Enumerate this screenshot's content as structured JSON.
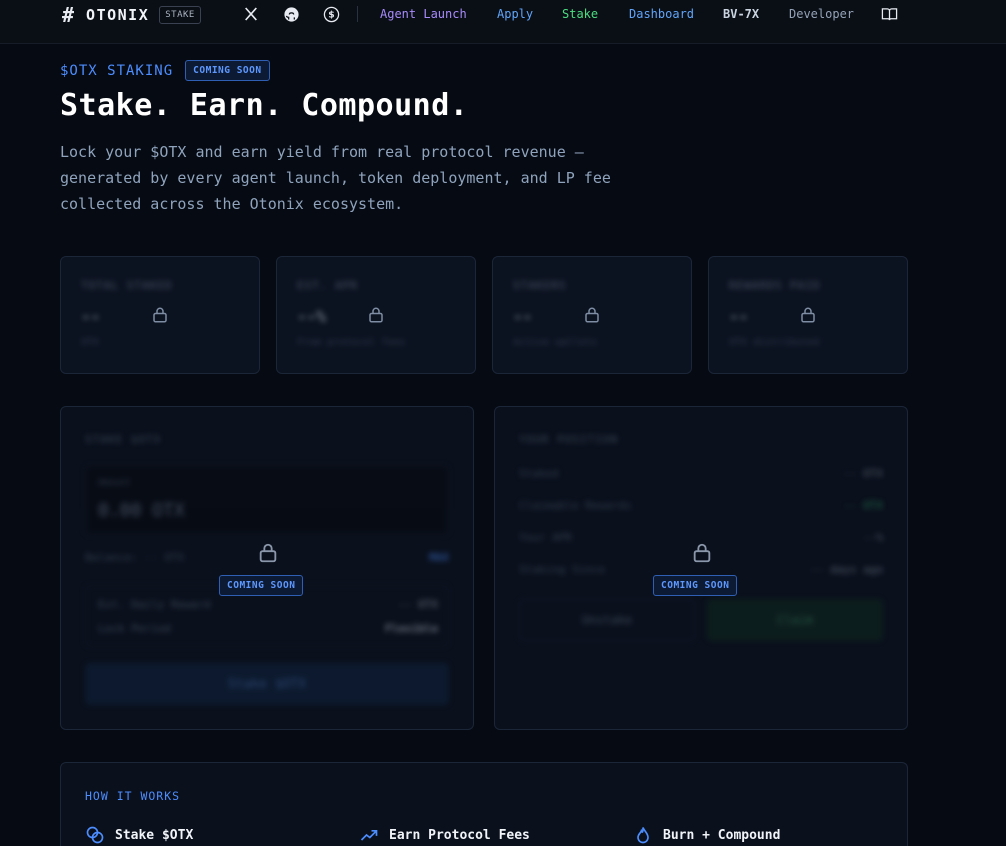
{
  "nav": {
    "brand_name": "OTONIX",
    "brand_tag": "STAKE",
    "icons": [
      "x-icon",
      "github-icon",
      "dollar-icon",
      "book-icon"
    ],
    "links": [
      {
        "label": "Agent Launch",
        "color": "#a78bfa"
      },
      {
        "label": "Apply",
        "color": "#60a5fa"
      },
      {
        "label": "Stake",
        "color": "#4ade80"
      },
      {
        "label": "Dashboard",
        "color": "#60a5fa"
      },
      {
        "label": "BV-7X",
        "color": "#cbd5e1"
      },
      {
        "label": "Developer",
        "color": "#94a3b8"
      }
    ]
  },
  "hero": {
    "eyebrow": "$OTX STAKING",
    "badge": "COMING SOON",
    "title": "Stake. Earn. Compound.",
    "description": "Lock your $OTX and earn yield from real protocol revenue — generated by every agent launch, token deployment, and LP fee collected across the Otonix ecosystem."
  },
  "stats": [
    {
      "label": "TOTAL STAKED",
      "value": "--",
      "sub": "OTX"
    },
    {
      "label": "EST. APR",
      "value": "--%",
      "sub": "From protocol fees"
    },
    {
      "label": "STAKERS",
      "value": "--",
      "sub": "Active wallets"
    },
    {
      "label": "REWARDS PAID",
      "value": "--",
      "sub": "OTX distributed"
    }
  ],
  "stake_panel": {
    "title": "STAKE $OTX",
    "amount_label": "Amount",
    "amount_value": "0.00 OTX",
    "balance": "Balance: -- OTX",
    "max": "MAX",
    "fee_rows": [
      {
        "label": "Est. Daily Reward",
        "value": "-- OTX"
      },
      {
        "label": "Lock Period",
        "value": "Flexible"
      }
    ],
    "button": "Stake $OTX",
    "badge": "COMING SOON"
  },
  "position_panel": {
    "title": "YOUR POSITION",
    "rows": [
      {
        "label": "Staked",
        "value": "-- OTX"
      },
      {
        "label": "Claimable Rewards",
        "value": "-- OTX"
      },
      {
        "label": "Your APR",
        "value": "--%"
      },
      {
        "label": "Staking Since",
        "value": "-- days ago"
      }
    ],
    "unstake": "Unstake",
    "claim": "Claim",
    "badge": "COMING SOON"
  },
  "how": {
    "title": "HOW IT WORKS",
    "items": [
      {
        "title": "Stake $OTX",
        "icon": "coins-icon"
      },
      {
        "title": "Earn Protocol Fees",
        "icon": "trending-up-icon"
      },
      {
        "title": "Burn + Compound",
        "icon": "flame-icon"
      }
    ]
  },
  "colors": {
    "accent": "#4c8dff",
    "green": "#4ade80",
    "background": "#060a12"
  }
}
